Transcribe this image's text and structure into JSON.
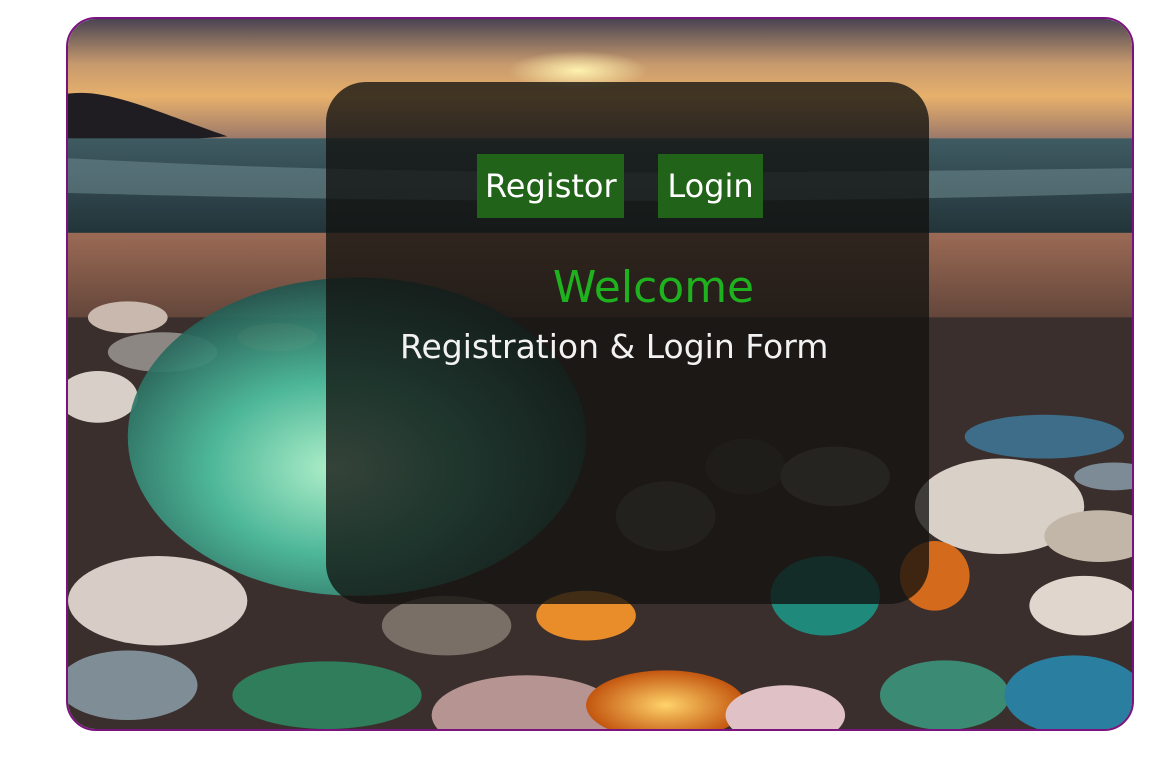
{
  "nav": {
    "register_label": "Registor",
    "login_label": "Login"
  },
  "hero": {
    "welcome": "Welcome",
    "subtitle": "Registration & Login Form"
  },
  "colors": {
    "frame_border": "#7a1380",
    "button_bg": "#216318",
    "welcome_text": "#1fb21f",
    "subtitle_text": "#f2f2f2"
  },
  "background": {
    "scene": "beach-with-glass-pebbles-at-sunset"
  }
}
